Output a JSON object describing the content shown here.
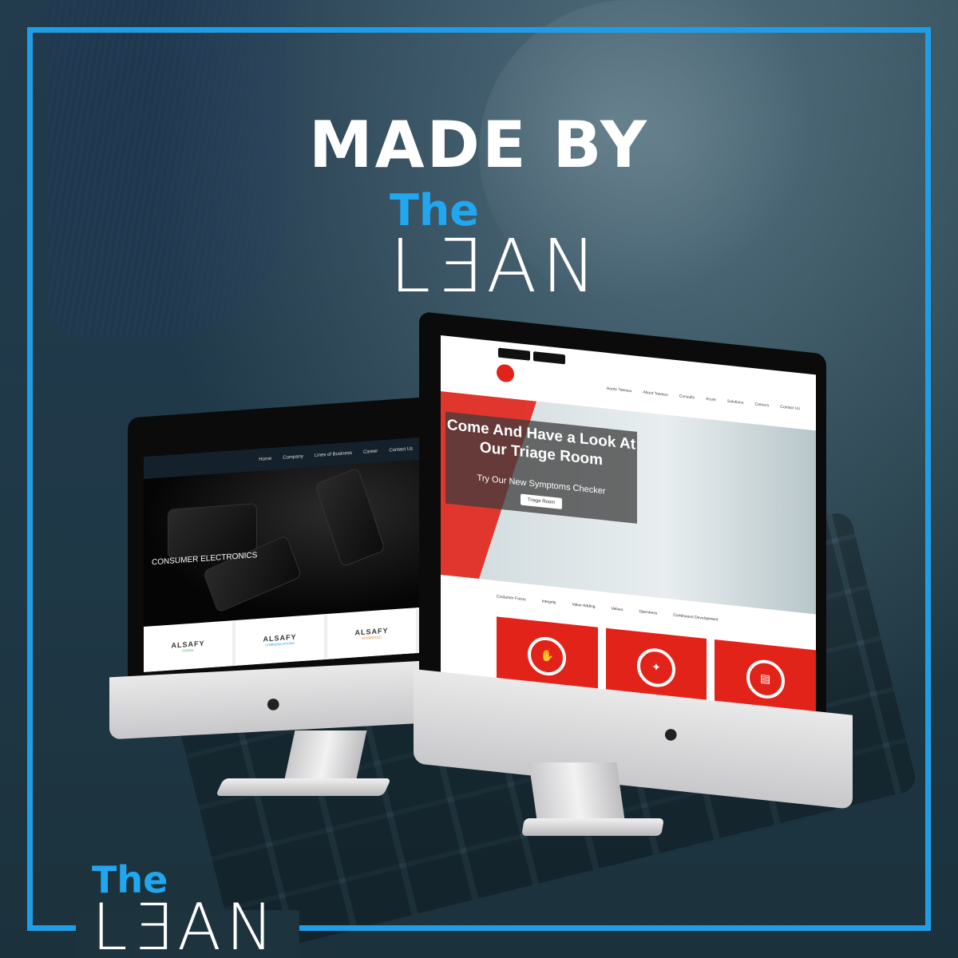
{
  "headline": "MADE BY",
  "logo": {
    "the": "The",
    "lean": "L∃AN"
  },
  "left_site": {
    "nav": [
      "Home",
      "Company",
      "Lines of Business",
      "Career",
      "Contact Us"
    ],
    "hero_title": "CONSUMER ELECTRONICS",
    "brands": [
      {
        "name": "ALSAFY",
        "sub": "FOODS",
        "color": "#3aa856"
      },
      {
        "name": "ALSAFY",
        "sub": "COMMUNICATIONS",
        "color": "#1f9ee6"
      },
      {
        "name": "ALSAFY",
        "sub": "HOUSEHOLD",
        "color": "#e77b1c"
      }
    ]
  },
  "right_site": {
    "nav": [
      "Home Tawasu",
      "About Tawasu",
      "Consults",
      "Acute",
      "Solutions",
      "Careers",
      "Contact Us"
    ],
    "hero_title": "Come And Have a Look At Our Triage Room",
    "hero_sub": "Try Our New Symptoms Checker",
    "hero_button": "Triage Room",
    "values": [
      "Customer Focus",
      "Integrity",
      "Value Adding",
      "Values",
      "Openness",
      "Continuous Development"
    ],
    "accent": "#e2231a"
  },
  "frame_color": "#1f9ee6"
}
